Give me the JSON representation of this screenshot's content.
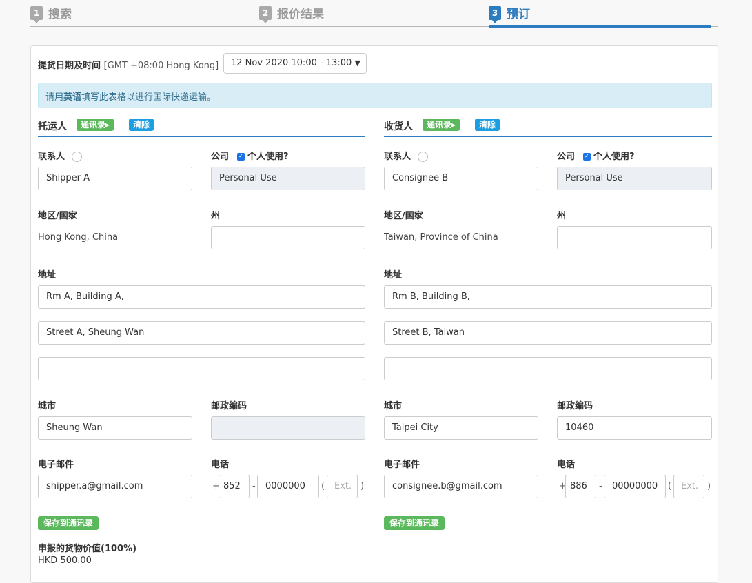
{
  "steps": [
    {
      "num": "1",
      "label": "搜索"
    },
    {
      "num": "2",
      "label": "报价结果"
    },
    {
      "num": "3",
      "label": "预订"
    }
  ],
  "pickup": {
    "label": "提货日期及时间",
    "timezone": "[GMT +08:00 Hong Kong]",
    "selected": "12 Nov 2020 10:00 - 13:00"
  },
  "alert": {
    "prefix": "请用",
    "emphasis": "英语",
    "suffix": "填写此表格以进行国际快递运输。"
  },
  "shipper": {
    "title": "托运人",
    "address_book_btn": "通讯录",
    "clear_btn": "清除",
    "contact_label": "联系人",
    "contact": "Shipper A",
    "company_label": "公司",
    "personal_use_label": "个人使用?",
    "company": "Personal Use",
    "country_label": "地区/国家",
    "country": "Hong Kong, China",
    "state_label": "州",
    "state": "",
    "address_label": "地址",
    "address1": "Rm A, Building A,",
    "address2": "Street A, Sheung Wan",
    "address3": "",
    "city_label": "城市",
    "city": "Sheung Wan",
    "postal_label": "邮政编码",
    "postal": "",
    "email_label": "电子邮件",
    "email": "shipper.a@gmail.com",
    "phone_label": "电话",
    "phone_cc": "852",
    "phone_num": "0000000",
    "phone_ext_placeholder": "Ext.",
    "save_btn": "保存到通讯录"
  },
  "consignee": {
    "title": "收货人",
    "address_book_btn": "通讯录",
    "clear_btn": "清除",
    "contact_label": "联系人",
    "contact": "Consignee B",
    "company_label": "公司",
    "personal_use_label": "个人使用?",
    "company": "Personal Use",
    "country_label": "地区/国家",
    "country": "Taiwan, Province of China",
    "state_label": "州",
    "state": "",
    "address_label": "地址",
    "address1": "Rm B, Building B,",
    "address2": "Street B, Taiwan",
    "address3": "",
    "city_label": "城市",
    "city": "Taipei City",
    "postal_label": "邮政编码",
    "postal": "10460",
    "email_label": "电子邮件",
    "email": "consignee.b@gmail.com",
    "phone_label": "电话",
    "phone_cc": "886",
    "phone_num": "00000000",
    "phone_ext_placeholder": "Ext.",
    "save_btn": "保存到通讯录"
  },
  "declared": {
    "label": "申报的货物价值(100%)",
    "value": "HKD 500.00"
  },
  "punct": {
    "plus": "+",
    "dash": "-",
    "open": "(",
    "close": ")"
  },
  "colors": {
    "accent": "#2c7cc0",
    "green": "#5cb85c",
    "blue_badge": "#1d9ee0",
    "alert_bg": "#d9edf7"
  }
}
